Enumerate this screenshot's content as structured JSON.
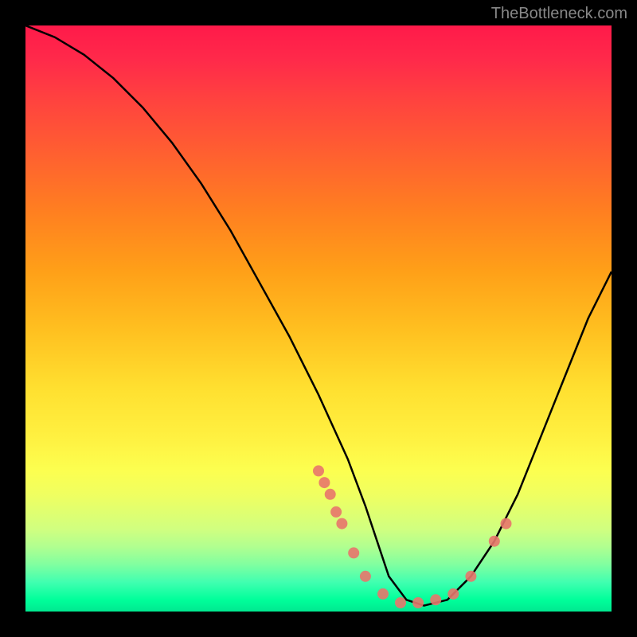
{
  "attribution": "TheBottleneck.com",
  "chart_data": {
    "type": "line",
    "title": "",
    "xlabel": "",
    "ylabel": "",
    "xlim": [
      0,
      100
    ],
    "ylim": [
      0,
      100
    ],
    "description": "Bottleneck curve on red-to-green gradient; V-shaped line with minimum near x≈62, scatter points cluster near trough.",
    "series": [
      {
        "name": "curve",
        "type": "line",
        "x": [
          0,
          5,
          10,
          15,
          20,
          25,
          30,
          35,
          40,
          45,
          50,
          55,
          58,
          60,
          62,
          65,
          68,
          72,
          76,
          80,
          84,
          88,
          92,
          96,
          100
        ],
        "values": [
          100,
          98,
          95,
          91,
          86,
          80,
          73,
          65,
          56,
          47,
          37,
          26,
          18,
          12,
          6,
          2,
          1,
          2,
          6,
          12,
          20,
          30,
          40,
          50,
          58
        ]
      },
      {
        "name": "points",
        "type": "scatter",
        "x": [
          50,
          51,
          52,
          53,
          54,
          56,
          58,
          61,
          64,
          67,
          70,
          73,
          76,
          80,
          82
        ],
        "values": [
          24,
          22,
          20,
          17,
          15,
          10,
          6,
          3,
          1.5,
          1.5,
          2,
          3,
          6,
          12,
          15
        ]
      }
    ]
  }
}
